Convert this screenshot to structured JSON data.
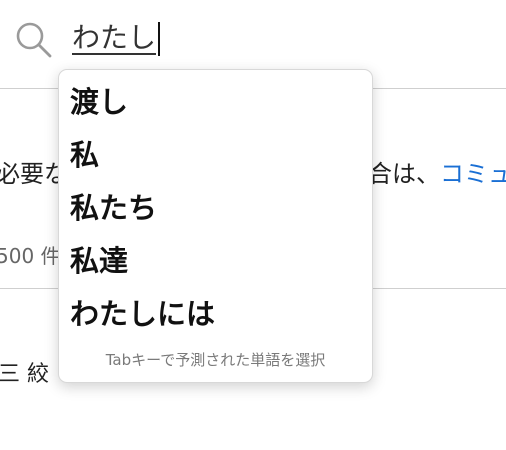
{
  "search": {
    "value": "わたし",
    "icon": "search-icon"
  },
  "background": {
    "line1_left": "必要な",
    "line1_right": "合は、",
    "line1_link": "コミュ",
    "count": "500 件",
    "filter": "三 絞"
  },
  "autocomplete": {
    "suggestions": [
      "渡し",
      "私",
      "私たち",
      "私達",
      "わたしには"
    ],
    "hint": "Tabキーで予測された単語を選択"
  }
}
